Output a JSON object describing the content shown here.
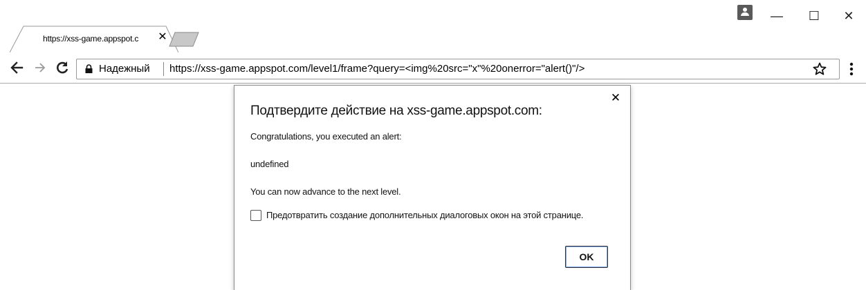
{
  "tab": {
    "title": "https://xss-game.appspot.c",
    "close_glyph": "✕"
  },
  "window_controls": {
    "minimize": "—",
    "maximize": "☐",
    "close": "✕"
  },
  "toolbar": {
    "back_glyph": "←",
    "forward_glyph": "→",
    "reload_glyph": "C",
    "secure_label": "Надежный",
    "url": "https://xss-game.appspot.com/level1/frame?query=<img%20src=\"x\"%20onerror=\"alert()\"/>"
  },
  "dialog": {
    "title": "Подтвердите действие на xss-game.appspot.com:",
    "line1": "Congratulations, you executed an alert:",
    "line2": "undefined",
    "line3": "You can now advance to the next level.",
    "checkbox_label": "Предотвратить создание дополнительных диалоговых окон на этой странице.",
    "checkbox_checked": false,
    "ok_label": "OK",
    "close_glyph": "✕"
  },
  "colors": {
    "tab_border": "#9a9a9a",
    "inactive_tab": "#c8c8c8",
    "ok_focus_ring": "#7ea6f0"
  }
}
